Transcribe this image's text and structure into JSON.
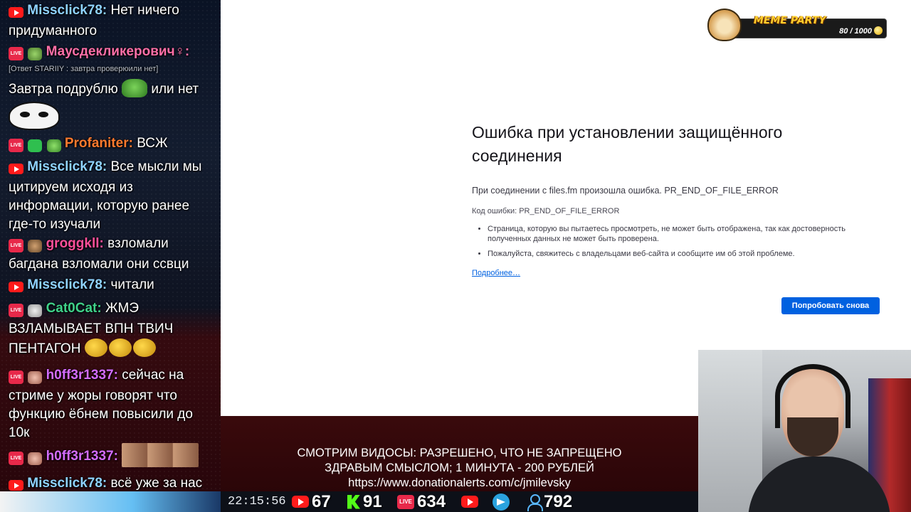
{
  "chat": {
    "messages": [
      {
        "platform": "youtube",
        "author": "Missclick78:",
        "author_color": "#8fd3ff",
        "text": "Нет ничего придуманного"
      },
      {
        "platform": "twitch",
        "author": "Маусдекликерович♀:",
        "author_color": "#ff6fa8",
        "reply": "[Ответ STARIIY  : завтра проверюили нет]",
        "text": "Завтра подрублю",
        "text_after": "или нет"
      },
      {
        "platform": "twitch",
        "author": "Profaniter:",
        "author_color": "#ff7a2e",
        "text": "ВСЖ"
      },
      {
        "platform": "youtube",
        "author": "Missclick78:",
        "author_color": "#8fd3ff",
        "text": "Все мысли мы цитируем исходя из информации, которую ранее где-то изучали"
      },
      {
        "platform": "twitch",
        "author": "groggkll:",
        "author_color": "#ff4f9a",
        "text": "взломали багдана взломали они ссвци"
      },
      {
        "platform": "youtube",
        "author": "Missclick78:",
        "author_color": "#8fd3ff",
        "text": "читали"
      },
      {
        "platform": "twitch",
        "author": "Cat0Cat:",
        "author_color": "#3fd28a",
        "text": "ЖМЭ ВЗЛАМЫВАЕТ ВПН ТВИЧ ПЕНТАГОН"
      },
      {
        "platform": "twitch",
        "author": "h0ff3r1337:",
        "author_color": "#d46cff",
        "text": "сейчас на стриме у жоры говорят что функцию ёбнем повысили до 10к"
      },
      {
        "platform": "twitch",
        "author": "h0ff3r1337:",
        "author_color": "#d46cff",
        "text": ""
      },
      {
        "platform": "youtube",
        "author": "Missclick78:",
        "author_color": "#8fd3ff",
        "text": "всё уже за нас придумано"
      }
    ]
  },
  "browser": {
    "error_title": "Ошибка при установлении защищённого соединения",
    "error_description": "При соединении с files.fm произошла ошибка. PR_END_OF_FILE_ERROR",
    "error_code": "Код ошибки: PR_END_OF_FILE_ERROR",
    "bullets": [
      "Страница, которую вы пытаетесь просмотреть, не может быть отображена, так как достоверность полученных данных не может быть проверена.",
      "Пожалуйста, свяжитесь с владельцами веб-сайта и сообщите им об этой проблеме."
    ],
    "learn_more": "Подробнее…",
    "retry_label": "Попробовать снова",
    "accent": "#0061e0"
  },
  "meme_party": {
    "title": "MEME PARTY",
    "progress_text": "80 / 1000",
    "progress_fraction": 0.08
  },
  "info": {
    "line1": "СМОТРИМ ВИДОСЫ: РАЗРЕШЕНО, ЧТО НЕ ЗАПРЕЩЕНО",
    "line2": "ЗДРАВЫМ СМЫСЛОМ; 1 МИНУТА - 200 РУБЛЕЙ",
    "line3": "https://www.donationalerts.com/c/jmilevsky"
  },
  "stats": {
    "clock": "22:15:56",
    "youtube_viewers": "67",
    "kick_viewers": "91",
    "twitch_viewers": "634",
    "total_viewers": "792",
    "live_badge": "LIVE"
  },
  "icons": [
    "youtube-icon",
    "kick-icon",
    "twitch-live-icon",
    "youtube-play-icon",
    "telegram-icon",
    "user-icon",
    "coin-icon",
    "doge-icon"
  ]
}
